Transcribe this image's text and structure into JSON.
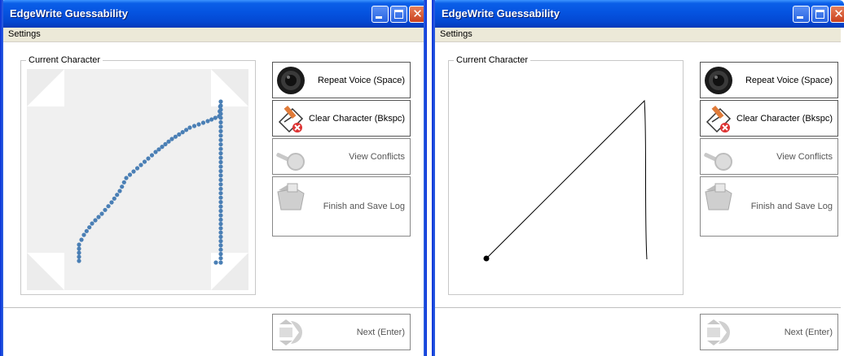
{
  "windows": [
    {
      "title": "EdgeWrite Guessability",
      "menu": {
        "settings": "Settings"
      },
      "group_label": "Current Character",
      "buttons": {
        "repeat_voice": "Repeat Voice (Space)",
        "clear_character": "Clear Character (Bkspc)",
        "view_conflicts": "View Conflicts",
        "finish_save": "Finish and Save Log",
        "next": "Next (Enter)"
      },
      "canvas_mode": "dots",
      "colors": {
        "dots": "#4a7fb5",
        "corners": "#ececec"
      }
    },
    {
      "title": "EdgeWrite Guessability",
      "menu": {
        "settings": "Settings"
      },
      "group_label": "Current Character",
      "buttons": {
        "repeat_voice": "Repeat Voice (Space)",
        "clear_character": "Clear Character (Bkspc)",
        "view_conflicts": "View Conflicts",
        "finish_save": "Finish and Save Log",
        "next": "Next (Enter)"
      },
      "canvas_mode": "line",
      "colors": {
        "line": "#000000"
      }
    }
  ]
}
